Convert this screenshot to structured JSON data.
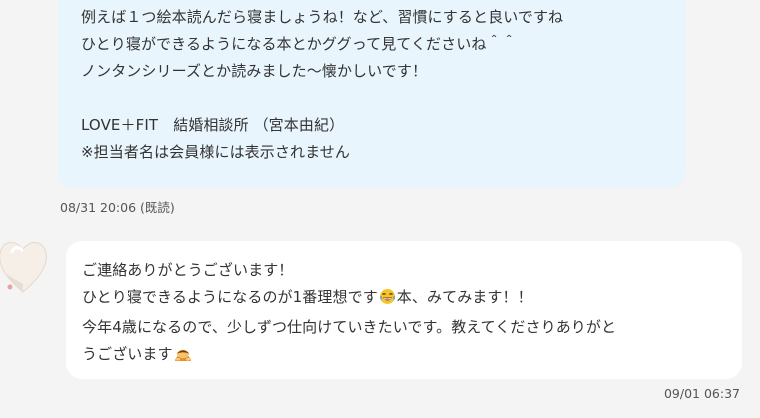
{
  "sent_message": {
    "lines": [
      "例えば１つ絵本読んだら寝ましょうね！など、習慣にすると良いですね",
      "ひとり寝ができるようになる本とかググって見てくださいね＾＾",
      "ノンタンシリーズとか読みました〜懐かしいです！",
      "LOVE＋FIT　結婚相談所 （宮本由紀）",
      "※担当者名は会員様には表示されません"
    ],
    "timestamp": "08/31 20:06",
    "status": "(既読)"
  },
  "received_message": {
    "line1": "ご連絡ありがとうございます！",
    "line2_before": "ひとり寝できるようになるのが1番理想です",
    "line2_emoji": "laughing-tears-emoji",
    "line2_after": "本、みてみます！！",
    "line3": "今年4歳になるので、少しずつ仕向けていきたいです。教えてくださりありがと",
    "line4_before": "うございます",
    "line4_emoji": "bowing-person-emoji",
    "timestamp": "09/01 06:37"
  },
  "colors": {
    "sent_bubble": "#e9f5fd",
    "received_bubble": "#ffffff",
    "background": "#f4f4f4"
  }
}
